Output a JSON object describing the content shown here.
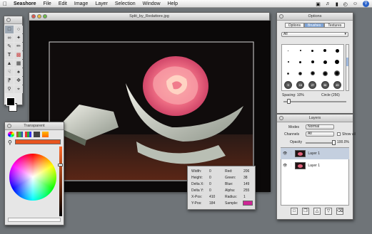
{
  "menubar": {
    "app": "Seashore",
    "items": [
      "File",
      "Edit",
      "Image",
      "Layer",
      "Selection",
      "Window",
      "Help"
    ]
  },
  "canvas_window": {
    "title": "Split_by_Redattore.jpg"
  },
  "stats": {
    "width_label": "Width:",
    "width": "0",
    "height_label": "Height:",
    "height": "0",
    "deltax_label": "Delta X:",
    "deltax": "0",
    "deltay_label": "Delta Y:",
    "deltay": "0",
    "xpos_label": "X-Pos:",
    "xpos": "410",
    "ypos_label": "Y-Pos:",
    "ypos": "184",
    "red_label": "Red:",
    "red": "206",
    "green_label": "Green:",
    "green": "38",
    "blue_label": "Blue:",
    "blue": "149",
    "alpha_label": "Alpha:",
    "alpha": "255",
    "radius_label": "Radius:",
    "radius": "1",
    "sample_label": "Sample:",
    "sample_color": "#ce2695"
  },
  "color_window": {
    "title": "Transparent",
    "current_color": "#e8541e"
  },
  "options_window": {
    "title": "Options",
    "tabs": [
      "Options",
      "Brushes",
      "Textures"
    ],
    "active_tab": "Brushes",
    "filter": "All",
    "brush_labels": [
      "9",
      "18",
      "27",
      "36",
      "45"
    ],
    "spacing_label": "Spacing: 10%",
    "circle_label": "Circle (256)"
  },
  "layers_window": {
    "title": "Layers",
    "modes_label": "Modes",
    "modes_value": "Normal",
    "channels_label": "Channels",
    "channels_value": "All",
    "show_all_label": "Show all",
    "opacity_label": "Opacity",
    "opacity_value": "100.0%",
    "layers": [
      {
        "name": "Layer 1"
      },
      {
        "name": "Layer 1"
      }
    ]
  },
  "toolbox": {
    "tools": [
      "rect-select-icon",
      "ellipse-select-icon",
      "lasso-icon",
      "wand-icon",
      "pencil-icon",
      "brush-icon",
      "text-icon",
      "eraser-icon",
      "fill-icon",
      "gradient-icon",
      "smudge-icon",
      "clone-icon",
      "eyedropper-icon",
      "move-icon",
      "zoom-icon",
      "crop-icon"
    ]
  }
}
